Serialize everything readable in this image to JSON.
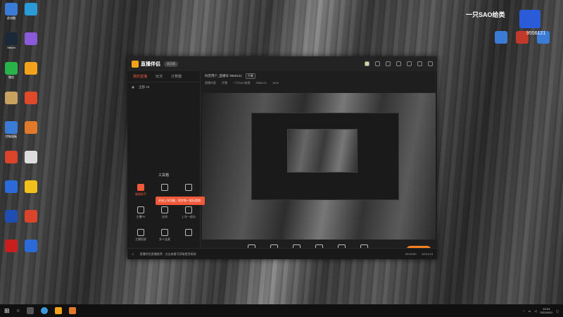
{
  "desktop": {
    "icons": [
      {
        "label": "此电脑",
        "color": "#3a7bd5"
      },
      {
        "label": "Steam",
        "color": "#1b2838"
      },
      {
        "label": "微信",
        "color": "#2ab24a"
      },
      {
        "label": "",
        "color": "#c8a060"
      },
      {
        "label": "控制面板",
        "color": "#3a7bd5"
      },
      {
        "label": "",
        "color": "#d9442a"
      },
      {
        "label": "",
        "color": "#2a6ad9"
      },
      {
        "label": "",
        "color": "#1e4fb0"
      },
      {
        "label": "",
        "color": "#c81e1e"
      },
      {
        "label": "",
        "color": "#2a9ad9"
      },
      {
        "label": "",
        "color": "#8a5ad9"
      },
      {
        "label": "",
        "color": "#f2a31a"
      },
      {
        "label": "",
        "color": "#e04a2a"
      },
      {
        "label": "",
        "color": "#e07a2a"
      },
      {
        "label": "",
        "color": "#ddd"
      },
      {
        "label": "",
        "color": "#f2c01a"
      },
      {
        "label": "",
        "color": "#d9442a"
      },
      {
        "label": "",
        "color": "#2a6ad9"
      }
    ],
    "right_icons": [
      {
        "label": "",
        "color": "#3a7bd5"
      },
      {
        "label": "",
        "color": "#c0392b"
      },
      {
        "label": "",
        "color": "#3a7bd5"
      }
    ],
    "overlay_text": "一只SAO给类",
    "overlay_number": "9556121"
  },
  "app": {
    "name": "直播伴侣",
    "version": "测试版",
    "tabs": [
      "我的直播",
      "玩法",
      "计算器"
    ],
    "viewers_label": "全部 28",
    "tools_title": "工具箱",
    "tools": [
      {
        "label": "福袋助手",
        "hot": true
      },
      {
        "label": "",
        "hot": false
      },
      {
        "label": "",
        "hot": false
      },
      {
        "label": "主播PK",
        "hot": false
      },
      {
        "label": "连线",
        "hot": false
      },
      {
        "label": "上车一起玩",
        "hot": false
      },
      {
        "label": "主播投屏",
        "hot": false
      },
      {
        "label": "多人连麦",
        "hot": false
      },
      {
        "label": "",
        "hot": false
      }
    ],
    "tooltip": "开启上车功能，同步和一起玩游戏~",
    "room": {
      "title": "抖音用户_直播号 9556121",
      "tag": "开播",
      "meta": [
        "直播内容",
        "开播",
        "一只SAO给我",
        "9556121",
        "1694"
      ]
    },
    "controls": [
      "直播屏幕",
      "摄像头",
      "手机投屏",
      "游戏",
      "麦克风",
      "扬声器"
    ],
    "go_live": "开始直播",
    "status": {
      "notice": "直播伴侣直播推荐：点击查看可获取更多帮助",
      "timer1": "00:00:00",
      "timer2": "00:01:13"
    }
  },
  "taskbar": {
    "time": "10:24",
    "date": "2021/9/21"
  }
}
